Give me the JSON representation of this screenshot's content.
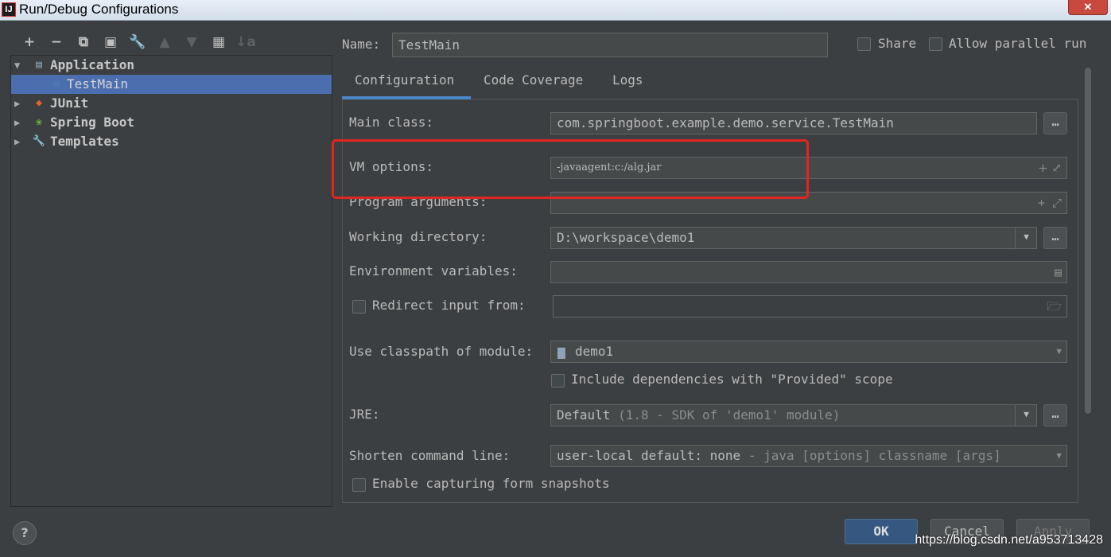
{
  "window": {
    "title": "Run/Debug Configurations",
    "app_icon": "IJ",
    "close_glyph": "✕"
  },
  "toolbar": [
    "+",
    "−",
    "⧉",
    "▣",
    "🔧",
    "▲",
    "▼",
    "▦",
    "↓a"
  ],
  "tree": {
    "application": "Application",
    "testmain": "TestMain",
    "junit": "JUnit",
    "springboot": "Spring Boot",
    "templates": "Templates"
  },
  "header": {
    "name_label": "Name:",
    "name_value": "TestMain",
    "share_label": "Share",
    "parallel_label": "Allow parallel run"
  },
  "tabs": [
    "Configuration",
    "Code Coverage",
    "Logs"
  ],
  "form": {
    "main_class_label": "Main class:",
    "main_class_value": "com.springboot.example.demo.service.TestMain",
    "vm_label": "VM options:",
    "vm_value": "-javaagent:c:/alg.jar",
    "program_label": "Program arguments:",
    "workdir_label": "Working directory:",
    "workdir_value": "D:\\workspace\\demo1",
    "env_label": "Environment variables:",
    "redirect_label": "Redirect input from:",
    "classpath_label": "Use classpath of module:",
    "classpath_value": "demo1",
    "include_deps_label": "Include dependencies with \"Provided\" scope",
    "jre_label": "JRE:",
    "jre_value": "Default",
    "jre_hint": "(1.8 - SDK of 'demo1' module)",
    "shorten_label": "Shorten command line:",
    "shorten_value": "user-local default: none",
    "shorten_hint": "- java [options] classname [args]",
    "snapshots_label": "Enable capturing form snapshots"
  },
  "buttons": {
    "help": "?",
    "ok": "OK",
    "cancel": "Cancel",
    "apply": "Apply"
  },
  "watermark": "https://blog.csdn.net/a953713428",
  "colors": {
    "selection": "#4b6eaf",
    "highlight_box": "#e0261d",
    "accent_tab": "#4a88c7"
  }
}
